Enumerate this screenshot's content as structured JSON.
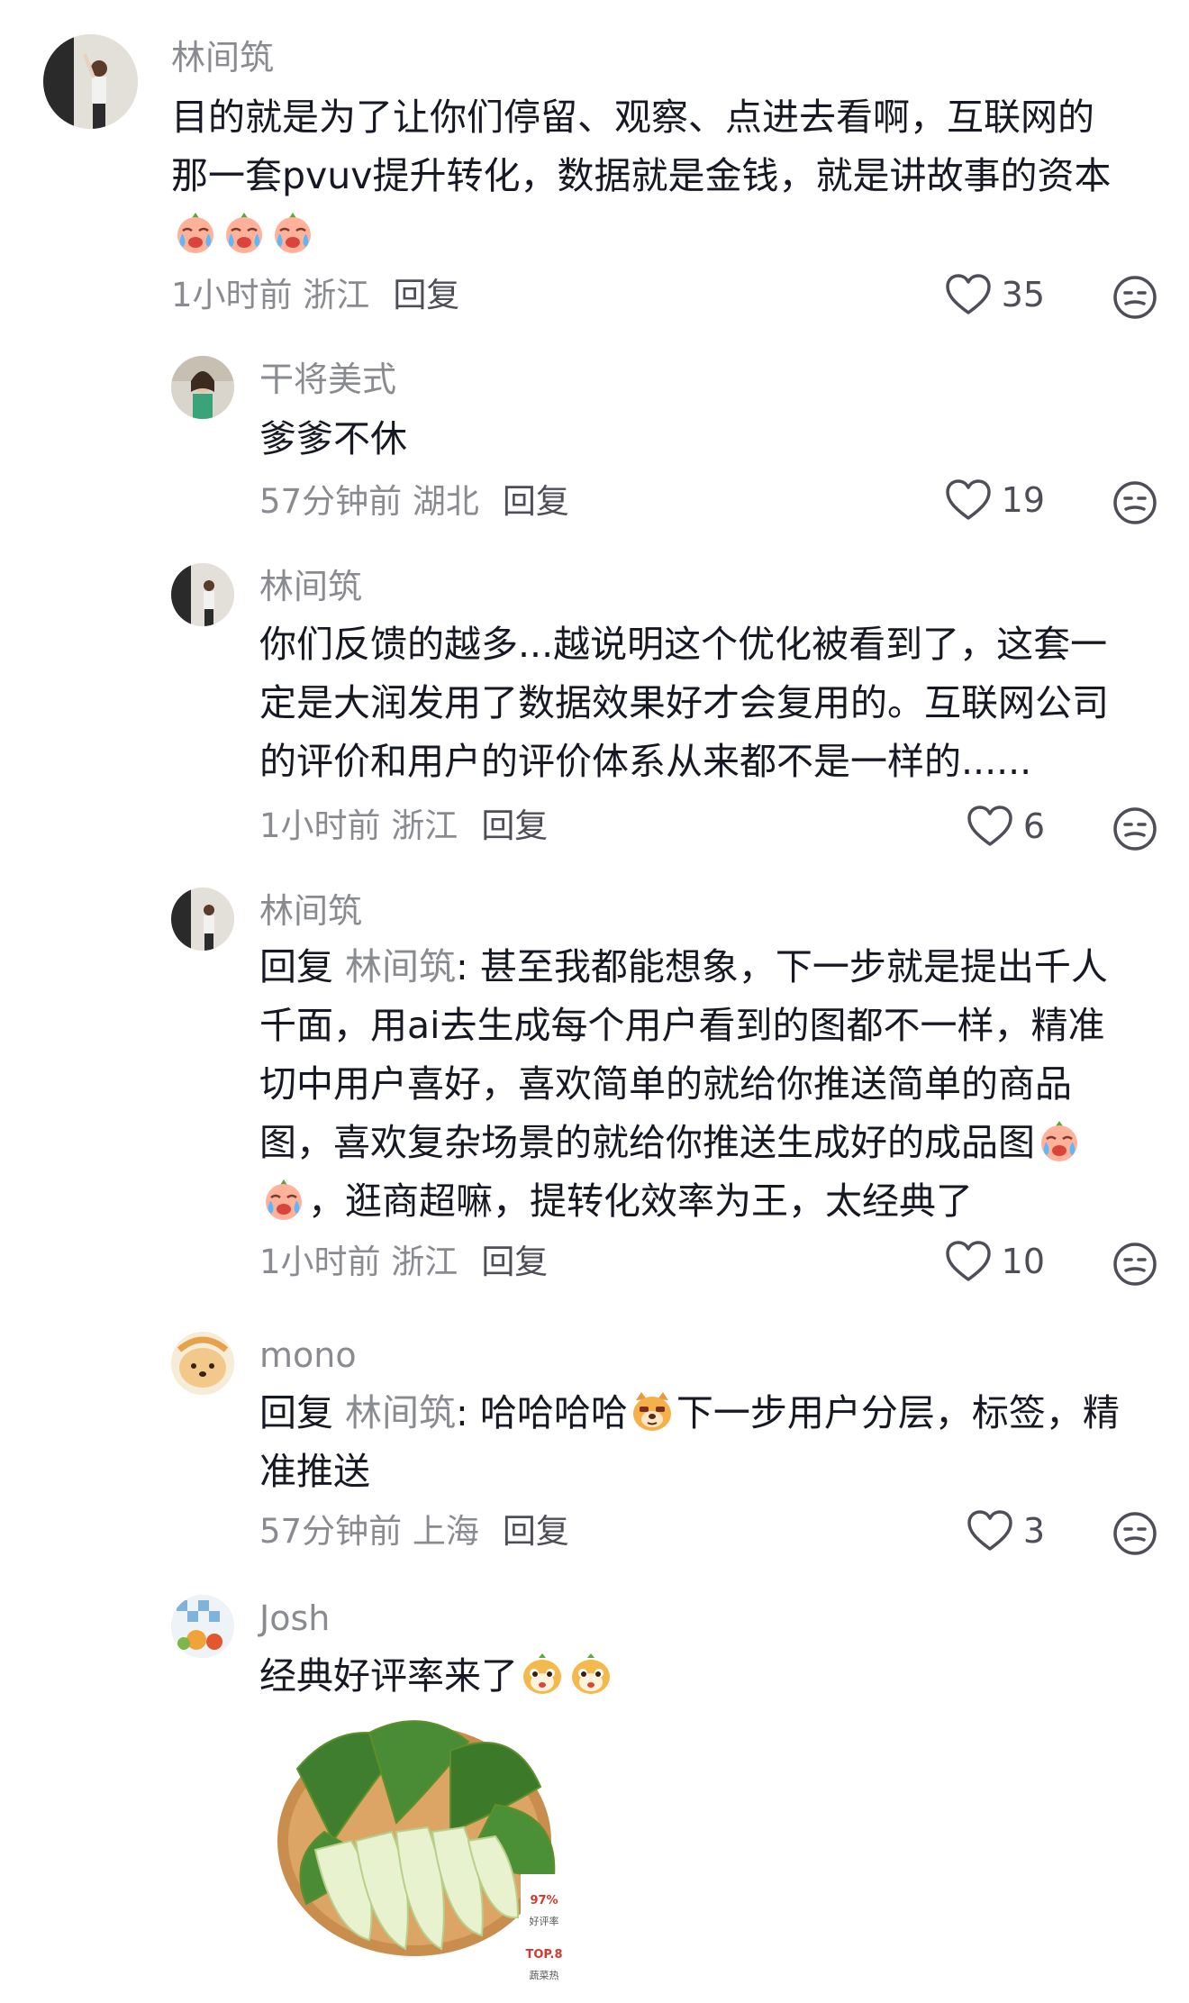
{
  "comments": [
    {
      "author": "林间筑",
      "lines": [
        "目的就是为了让你们停留、观察、点进去看啊，互联网的",
        "那一套pvuv提升转化，数据就是金钱，就是讲故事的资本"
      ],
      "time_loc": "1小时前 浙江",
      "reply_label": "回复",
      "likes": "35"
    },
    {
      "author": "干将美式",
      "lines": [
        "爹爹不休"
      ],
      "time_loc": "57分钟前 湖北",
      "reply_label": "回复",
      "likes": "19"
    },
    {
      "author": "林间筑",
      "lines": [
        "你们反馈的越多...越说明这个优化被看到了，这套一",
        "定是大润发用了数据效果好才会复用的。互联网公司",
        "的评价和用户的评价体系从来都不是一样的......"
      ],
      "time_loc": "1小时前 浙江",
      "reply_label": "回复",
      "likes": "6"
    },
    {
      "author": "林间筑",
      "reply_prefix": "回复",
      "reply_to": "林间筑",
      "line1_rest": ": 甚至我都能想象，下一步就是提出千人",
      "lines": [
        "千面，用ai去生成每个用户看到的图都不一样，精准",
        "切中用户喜好，喜欢简单的就给你推送简单的商品",
        "图，喜欢复杂场景的就给你推送生成好的成品图"
      ],
      "last_line": "，逛商超嘛，提转化效率为王，太经典了",
      "time_loc": "1小时前 浙江",
      "reply_label": "回复",
      "likes": "10"
    },
    {
      "author": "mono",
      "reply_prefix": "回复",
      "reply_to": "林间筑",
      "line1_mid": ": 哈哈哈哈",
      "line1_end": "下一步用户分层，标签，精",
      "line2": "准推送",
      "time_loc": "57分钟前 上海",
      "reply_label": "回复",
      "likes": "3"
    },
    {
      "author": "Josh",
      "text": "经典好评率来了",
      "image_badge": {
        "pct": "97%",
        "label": "好评率",
        "rank": "TOP.8",
        "rank_label": "蔬菜热"
      }
    }
  ],
  "icons": {
    "like": "heart-icon",
    "dislike": "dislike-face-icon"
  },
  "colors": {
    "text": "#161823",
    "secondary": "#8a8b91",
    "background": "#ffffff"
  }
}
